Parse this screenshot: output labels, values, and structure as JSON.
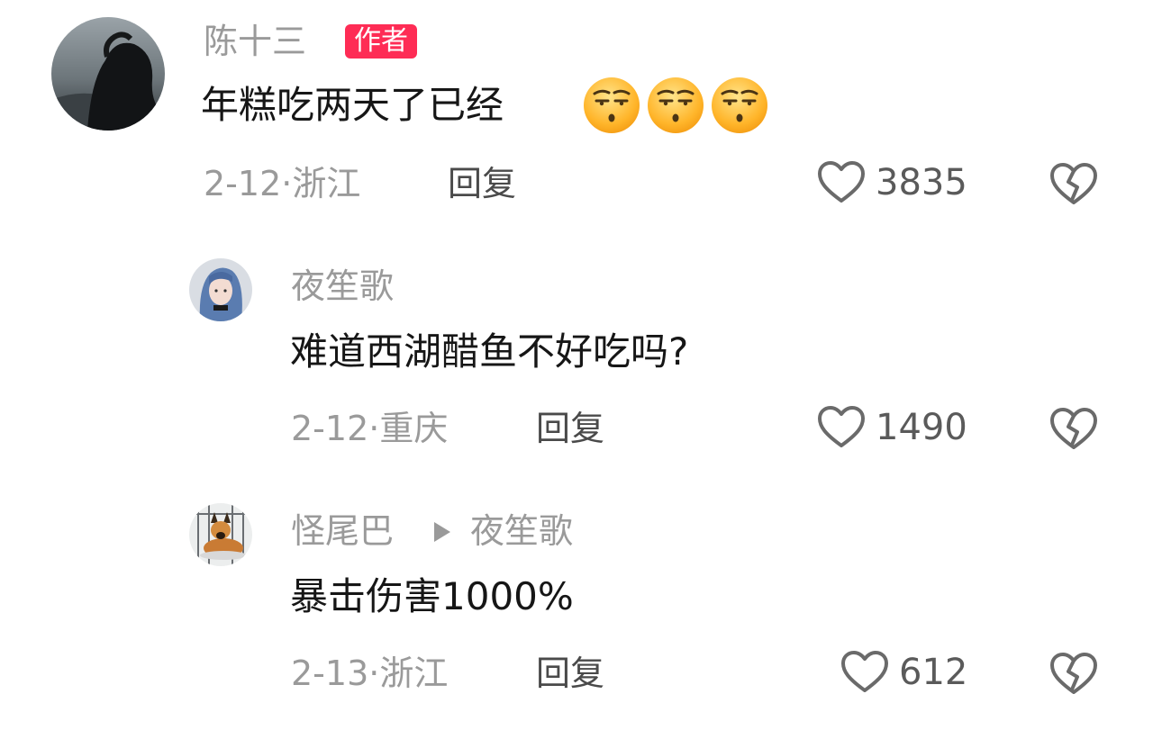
{
  "comments": [
    {
      "username": "陈十三",
      "badge": "作者",
      "text": "年糕吃两天了已经",
      "emoji": [
        "unamused-face-emoji",
        "unamused-face-emoji",
        "unamused-face-emoji"
      ],
      "meta": "2-12·浙江",
      "reply_label": "回复",
      "likes": "3835"
    },
    {
      "username": "夜笙歌",
      "text": "难道西湖醋鱼不好吃吗?",
      "meta": "2-12·重庆",
      "reply_label": "回复",
      "likes": "1490"
    },
    {
      "username": "怪尾巴",
      "reply_to": "夜笙歌",
      "text": "暴击伤害1000%",
      "meta": "2-13·浙江",
      "reply_label": "回复",
      "likes": "612"
    }
  ],
  "colors": {
    "badge": "#fe2c55",
    "secondary_text": "#9a9a9a",
    "icon": "#6a6a6a"
  }
}
